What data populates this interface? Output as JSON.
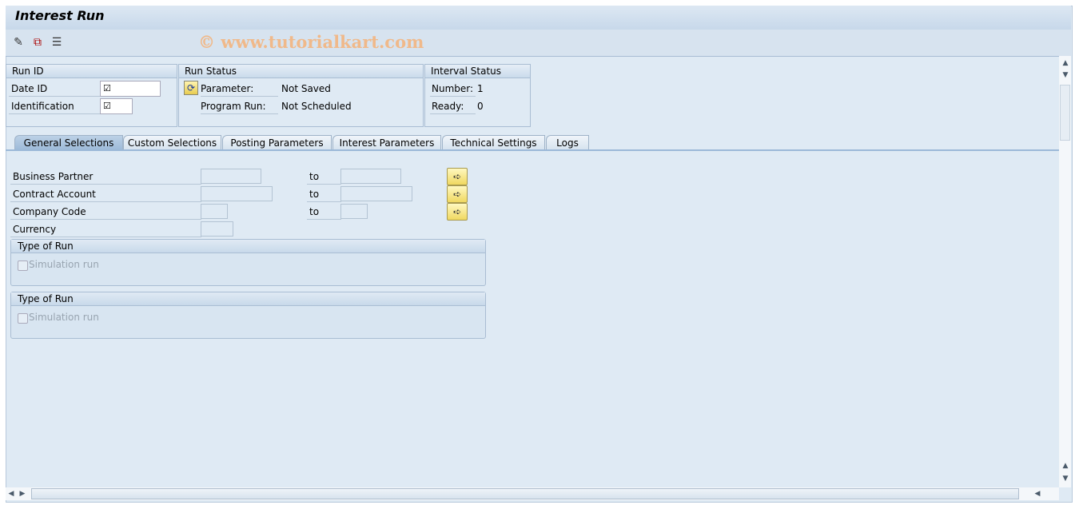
{
  "title": "Interest Run",
  "watermark": "© www.tutorialkart.com",
  "toolbar": {
    "icons": [
      "edit-icon",
      "copy-icon",
      "structure-icon"
    ]
  },
  "run_id": {
    "header": "Run ID",
    "date_id_label": "Date ID",
    "identification_label": "Identification",
    "date_id_value": "☑",
    "identification_value": "☑"
  },
  "run_status": {
    "header": "Run Status",
    "parameter_label": "Parameter:",
    "parameter_value": "Not Saved",
    "program_run_label": "Program Run:",
    "program_run_value": "Not Scheduled"
  },
  "interval_status": {
    "header": "Interval Status",
    "number_label": "Number:",
    "number_value": "1",
    "ready_label": "Ready:",
    "ready_value": "0"
  },
  "tabs": [
    {
      "label": "General Selections",
      "active": true
    },
    {
      "label": "Custom Selections"
    },
    {
      "label": "Posting Parameters"
    },
    {
      "label": "Interest Parameters"
    },
    {
      "label": "Technical Settings"
    },
    {
      "label": "Logs"
    }
  ],
  "fields": {
    "to": "to",
    "business_partner": "Business Partner",
    "contract_account": "Contract Account",
    "company_code": "Company Code",
    "currency": "Currency"
  },
  "groups": [
    {
      "header": "Type of Run",
      "checkbox": "Simulation run",
      "checked": false
    },
    {
      "header": "Type of Run",
      "checkbox": "Simulation run",
      "checked": false
    }
  ],
  "colors": {
    "background": "#dfeaf4",
    "watermark": "#f0b98a",
    "select_button": "#f0d860"
  }
}
